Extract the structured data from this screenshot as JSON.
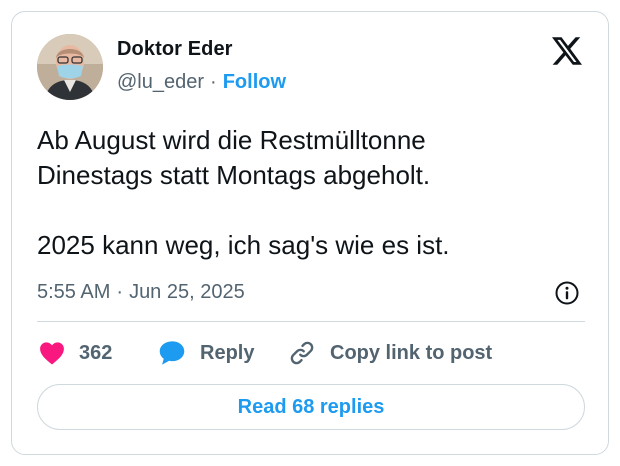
{
  "author": {
    "name": "Doktor Eder",
    "handle": "@lu_eder",
    "separator": "·",
    "follow_label": "Follow"
  },
  "platform_icon": "x-logo-icon",
  "tweet": {
    "lines_1": [
      "Ab August wird die Restmülltonne",
      "Dinestags statt Montags abgeholt."
    ],
    "line_2": "2025 kann weg, ich sag's wie es ist.",
    "time": "5:55 AM",
    "separator": "·",
    "date": "Jun 25, 2025"
  },
  "actions": {
    "like_count": "362",
    "reply_label": "Reply",
    "copy_label": "Copy link to post"
  },
  "read_replies_label": "Read 68 replies",
  "colors": {
    "accent": "#1d9bf0",
    "like": "#f91880",
    "text": "#0f1419",
    "muted": "#536471",
    "border": "#cfd9de"
  }
}
